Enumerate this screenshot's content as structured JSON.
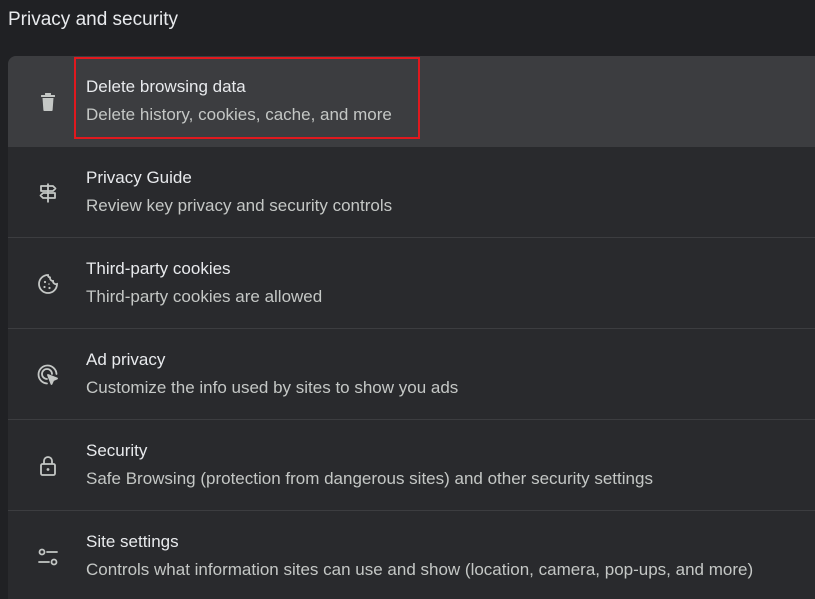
{
  "section": {
    "title": "Privacy and security"
  },
  "items": [
    {
      "icon": "trash-icon",
      "title": "Delete browsing data",
      "subtitle": "Delete history, cookies, cache, and more"
    },
    {
      "icon": "signpost-icon",
      "title": "Privacy Guide",
      "subtitle": "Review key privacy and security controls"
    },
    {
      "icon": "cookie-icon",
      "title": "Third-party cookies",
      "subtitle": "Third-party cookies are allowed"
    },
    {
      "icon": "ad-privacy-icon",
      "title": "Ad privacy",
      "subtitle": "Customize the info used by sites to show you ads"
    },
    {
      "icon": "lock-icon",
      "title": "Security",
      "subtitle": "Safe Browsing (protection from dangerous sites) and other security settings"
    },
    {
      "icon": "tune-icon",
      "title": "Site settings",
      "subtitle": "Controls what information sites can use and show (location, camera, pop-ups, and more)"
    }
  ],
  "colors": {
    "background": "#202124",
    "card": "#292a2d",
    "hover_row": "#3c3d40",
    "highlight_border": "#e0191e"
  }
}
